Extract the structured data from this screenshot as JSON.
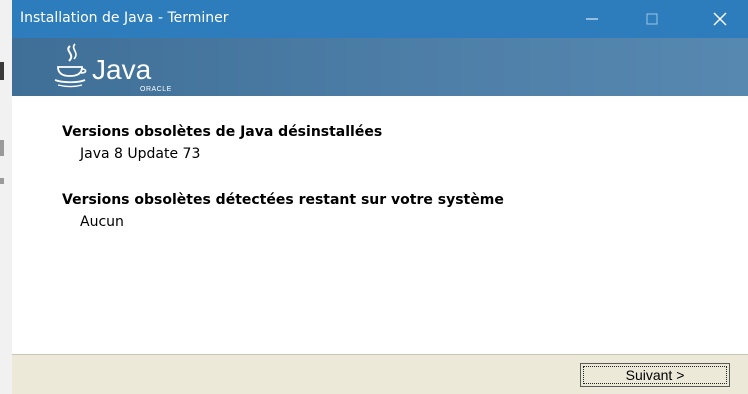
{
  "window": {
    "title": "Installation de Java - Terminer",
    "controls": [
      "minimize-icon",
      "maximize-icon",
      "close-icon"
    ],
    "titlebar_color": "#2d7dbd"
  },
  "banner": {
    "logo_word": "Java",
    "logo_subtext": "ORACLE",
    "color": "#4d7ea7"
  },
  "content": {
    "section1": {
      "heading": "Versions obsolètes de Java désinstallées",
      "value": "Java 8 Update 73"
    },
    "section2": {
      "heading": "Versions obsolètes détectées restant sur votre système",
      "value": "Aucun"
    }
  },
  "footer": {
    "next_label": "Suivant >"
  }
}
